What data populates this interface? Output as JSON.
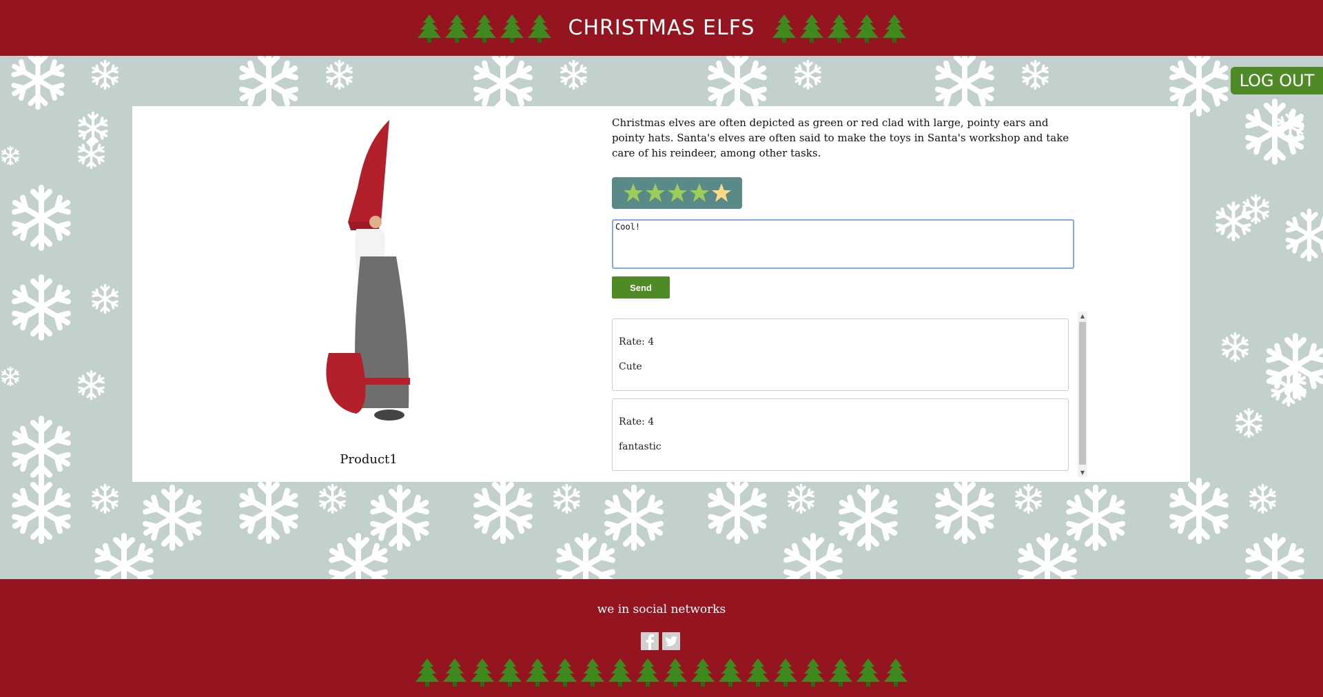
{
  "header": {
    "title": "CHRISTMAS ELFS"
  },
  "auth": {
    "logout_label": "LOG OUT"
  },
  "product": {
    "name": "Product1",
    "description": "Christmas elves are often depicted as green or red clad with large, pointy ears and pointy hats. Santa's elves are often said to make the toys in Santa's workshop and take care of his reindeer, among other tasks."
  },
  "rating_widget": {
    "max_stars": 5,
    "highlighted_star": 5
  },
  "comment_form": {
    "value": "Cool!",
    "send_label": "Send"
  },
  "reviews": [
    {
      "rate": "Rate: 4",
      "text": "Cute"
    },
    {
      "rate": "Rate: 4",
      "text": "fantastic"
    }
  ],
  "footer": {
    "social_title": "we in social networks"
  },
  "icons": {
    "tree": "christmas-tree-icon",
    "star": "star-icon",
    "facebook": "facebook-icon",
    "twitter": "twitter-icon",
    "snowflake": "snowflake-icon"
  },
  "colors": {
    "header_bg": "#94151f",
    "background": "#c3d1ce",
    "accent_green": "#4e8b26",
    "rating_bg": "#5a8a87",
    "star_green": "#9ccc5a",
    "star_yellow": "#ffd986"
  }
}
